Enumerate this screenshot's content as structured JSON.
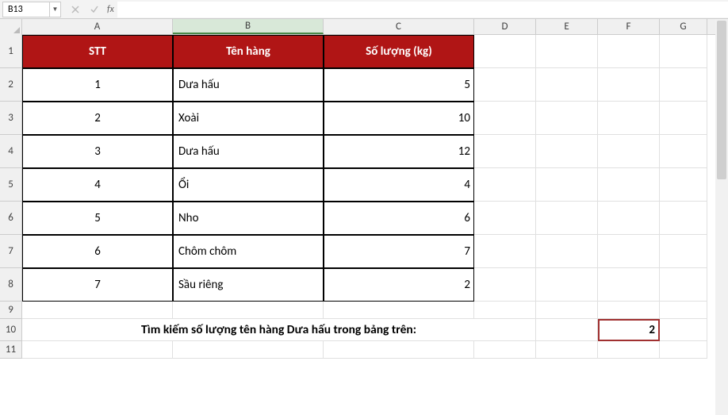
{
  "name_box": "B13",
  "formula_value": "",
  "cols": [
    {
      "label": "A",
      "w": 190
    },
    {
      "label": "B",
      "w": 190
    },
    {
      "label": "C",
      "w": 190
    },
    {
      "label": "D",
      "w": 78
    },
    {
      "label": "E",
      "w": 78
    },
    {
      "label": "F",
      "w": 78
    },
    {
      "label": "G",
      "w": 60
    }
  ],
  "header_row_h": 42,
  "data_row_h": 42,
  "short_row_h": 22,
  "thead": {
    "A": "STT",
    "B": "Tên hàng",
    "C": "Số lượng (kg)"
  },
  "rows": [
    {
      "A": "1",
      "B": "Dưa hấu",
      "C": "5"
    },
    {
      "A": "2",
      "B": "Xoài",
      "C": "10"
    },
    {
      "A": "3",
      "B": "Dưa hấu",
      "C": "12"
    },
    {
      "A": "4",
      "B": "Ổi",
      "C": "4"
    },
    {
      "A": "5",
      "B": "Nho",
      "C": "6"
    },
    {
      "A": "6",
      "B": "Chôm chôm",
      "C": "7"
    },
    {
      "A": "7",
      "B": "Sầu riêng",
      "C": "2"
    }
  ],
  "lookup": {
    "label": "Tìm kiếm số lượng tên hàng Dưa hấu trong bảng trên:",
    "result": "2"
  },
  "selected_cell": "B13",
  "chart_data": {
    "type": "table",
    "title": "",
    "columns": [
      "STT",
      "Tên hàng",
      "Số lượng (kg)"
    ],
    "data": [
      [
        1,
        "Dưa hấu",
        5
      ],
      [
        2,
        "Xoài",
        10
      ],
      [
        3,
        "Dưa hấu",
        12
      ],
      [
        4,
        "Ổi",
        4
      ],
      [
        5,
        "Nho",
        6
      ],
      [
        6,
        "Chôm chôm",
        7
      ],
      [
        7,
        "Sầu riêng",
        2
      ]
    ],
    "lookup_query": "Tìm kiếm số lượng tên hàng Dưa hấu trong bảng trên:",
    "lookup_result": 2
  }
}
